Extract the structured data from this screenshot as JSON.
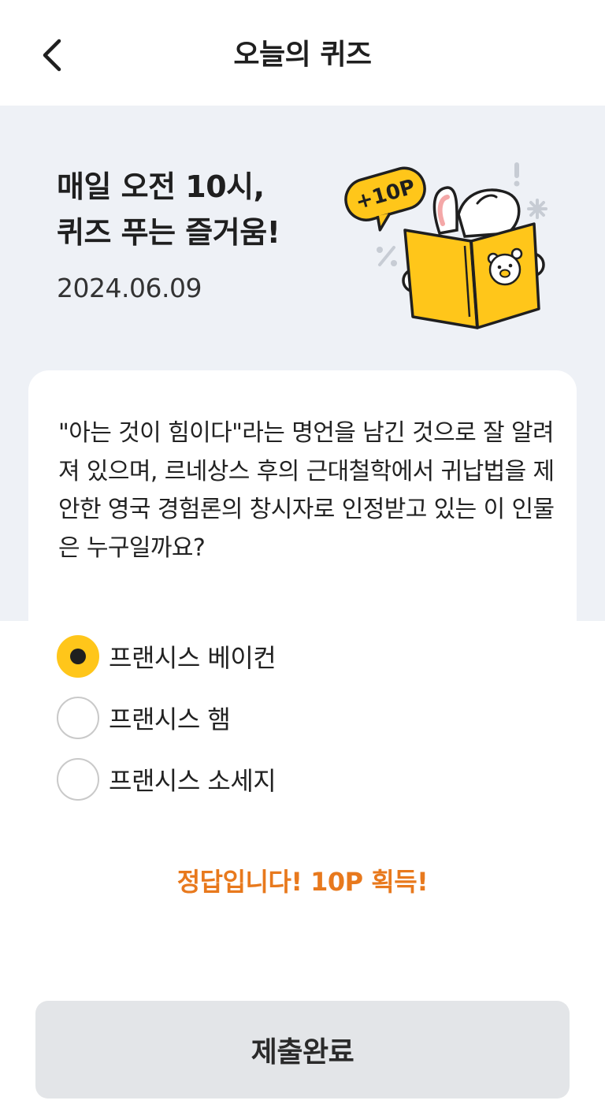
{
  "header": {
    "title": "오늘의 퀴즈",
    "back_icon": "chevron-left-icon"
  },
  "hero": {
    "title_line1": "매일 오전 10시,",
    "title_line2": "퀴즈 푸는 즐거움!",
    "date": "2024.06.09",
    "badge_text": "+10P"
  },
  "quiz": {
    "question": "\"아는 것이 힘이다\"라는 명언을 남긴 것으로 잘 알려져 있으며, 르네상스 후의 근대철학에서 귀납법을 제안한 영국 경험론의 창시자로 인정받고 있는 이 인물은 누구일까요?",
    "options": [
      {
        "label": "프랜시스 베이컨",
        "selected": true
      },
      {
        "label": "프랜시스 햄",
        "selected": false
      },
      {
        "label": "프랜시스 소세지",
        "selected": false
      }
    ],
    "result_message": "정답입니다! 10P 획득!"
  },
  "submit": {
    "label": "제출완료"
  },
  "colors": {
    "accent": "#ffc61a",
    "result": "#e8791d",
    "hero_bg": "#eef1f6",
    "button_bg": "#e3e5e8"
  }
}
